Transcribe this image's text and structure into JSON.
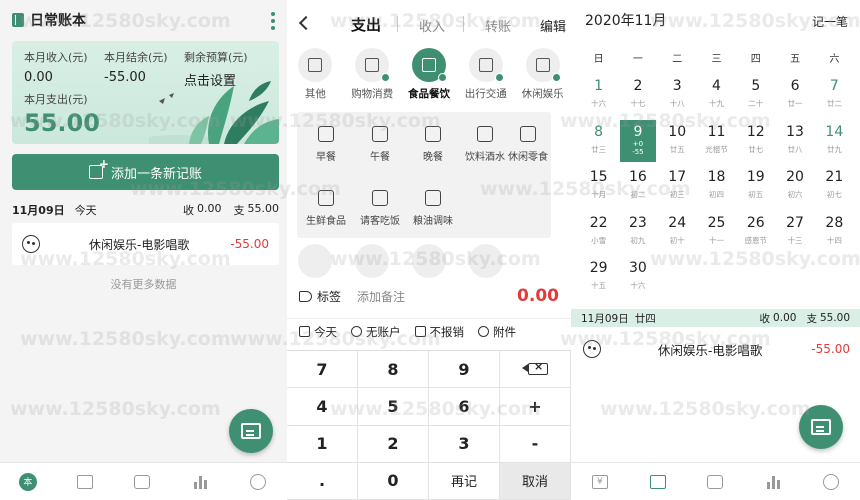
{
  "colors": {
    "accent": "#3f8f73",
    "expense": "#e23b3b",
    "selected_row": "#d9efe5"
  },
  "watermark": "www.12580sky.com",
  "home": {
    "title": "日常账本",
    "stats": [
      {
        "label": "本月收入(元)",
        "value": "0.00"
      },
      {
        "label": "本月结余(元)",
        "value": "-55.00"
      },
      {
        "label": "剩余预算(元)",
        "value": "点击设置"
      }
    ],
    "spend_label": "本月支出(元)",
    "spend_value": "55.00",
    "add_button": "添加一条新记账",
    "day": {
      "date": "11月09日",
      "weekday": "今天",
      "income_label": "收",
      "income": "0.00",
      "expense_label": "支",
      "expense": "55.00"
    },
    "record": {
      "category": "休闲娱乐-电影唱歌",
      "amount": "-55.00"
    },
    "no_more": "没有更多数据",
    "tabs": [
      {
        "icon": "home-icon",
        "label": "本"
      },
      {
        "icon": "calendar-icon"
      },
      {
        "icon": "wallet-icon"
      },
      {
        "icon": "chart-icon"
      },
      {
        "icon": "profile-icon"
      }
    ]
  },
  "entry": {
    "tabs": [
      "支出",
      "收入",
      "转账",
      "编辑"
    ],
    "categories": [
      {
        "label": "其他",
        "icon": "book-icon"
      },
      {
        "label": "购物消费",
        "icon": "bag-icon"
      },
      {
        "label": "食品餐饮",
        "icon": "cutlery-icon",
        "active": true
      },
      {
        "label": "出行交通",
        "icon": "traffic-light-icon"
      },
      {
        "label": "休闲娱乐",
        "icon": "tv-icon"
      }
    ],
    "subcategories": [
      "早餐",
      "午餐",
      "晚餐",
      "饮料酒水",
      "休闲零食",
      "生鲜食品",
      "请客吃饭",
      "粮油调味"
    ],
    "tag_label": "标签",
    "note_placeholder": "添加备注",
    "amount": "0.00",
    "options": [
      "今天",
      "无账户",
      "不报销",
      "附件"
    ],
    "keys": [
      "7",
      "8",
      "9",
      "",
      "4",
      "5",
      "6",
      "+",
      "1",
      "2",
      "3",
      "-",
      ".",
      "0",
      "再记",
      "取消"
    ]
  },
  "calendar": {
    "month": "2020年11月",
    "add_label": "记一笔",
    "weekdays": [
      "日",
      "一",
      "二",
      "三",
      "四",
      "五",
      "六"
    ],
    "days": [
      {
        "n": "1",
        "lunar": "十六"
      },
      {
        "n": "2",
        "lunar": "十七"
      },
      {
        "n": "3",
        "lunar": "十八"
      },
      {
        "n": "4",
        "lunar": "十九"
      },
      {
        "n": "5",
        "lunar": "二十"
      },
      {
        "n": "6",
        "lunar": "廿一"
      },
      {
        "n": "7",
        "lunar": "廿二"
      },
      {
        "n": "8",
        "lunar": "廿三"
      },
      {
        "n": "9",
        "lunar": "+0",
        "extra": "-55",
        "selected": true
      },
      {
        "n": "10",
        "lunar": "廿五"
      },
      {
        "n": "11",
        "lunar": "光棍节"
      },
      {
        "n": "12",
        "lunar": "廿七"
      },
      {
        "n": "13",
        "lunar": "廿八"
      },
      {
        "n": "14",
        "lunar": "廿九"
      },
      {
        "n": "15",
        "lunar": "十月"
      },
      {
        "n": "16",
        "lunar": "初二"
      },
      {
        "n": "17",
        "lunar": "初三"
      },
      {
        "n": "18",
        "lunar": "初四"
      },
      {
        "n": "19",
        "lunar": "初五"
      },
      {
        "n": "20",
        "lunar": "初六"
      },
      {
        "n": "21",
        "lunar": "初七"
      },
      {
        "n": "22",
        "lunar": "小雪"
      },
      {
        "n": "23",
        "lunar": "初九"
      },
      {
        "n": "24",
        "lunar": "初十"
      },
      {
        "n": "25",
        "lunar": "十一"
      },
      {
        "n": "26",
        "lunar": "感恩节"
      },
      {
        "n": "27",
        "lunar": "十三"
      },
      {
        "n": "28",
        "lunar": "十四"
      },
      {
        "n": "29",
        "lunar": "十五"
      },
      {
        "n": "30",
        "lunar": "十六"
      }
    ],
    "selected": {
      "date": "11月09日",
      "lunar": "廿四",
      "income_label": "收",
      "income": "0.00",
      "expense_label": "支",
      "expense": "55.00"
    },
    "record": {
      "category": "休闲娱乐-电影唱歌",
      "amount": "-55.00"
    }
  }
}
